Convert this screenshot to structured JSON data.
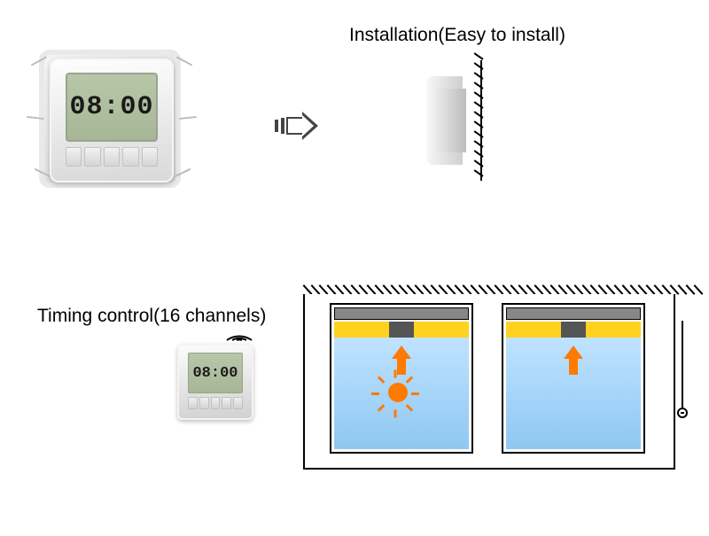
{
  "installation": {
    "title": "Installation(Easy to install)"
  },
  "timing": {
    "title": "Timing control(16 channels)"
  },
  "device": {
    "time_display": "08:00"
  }
}
